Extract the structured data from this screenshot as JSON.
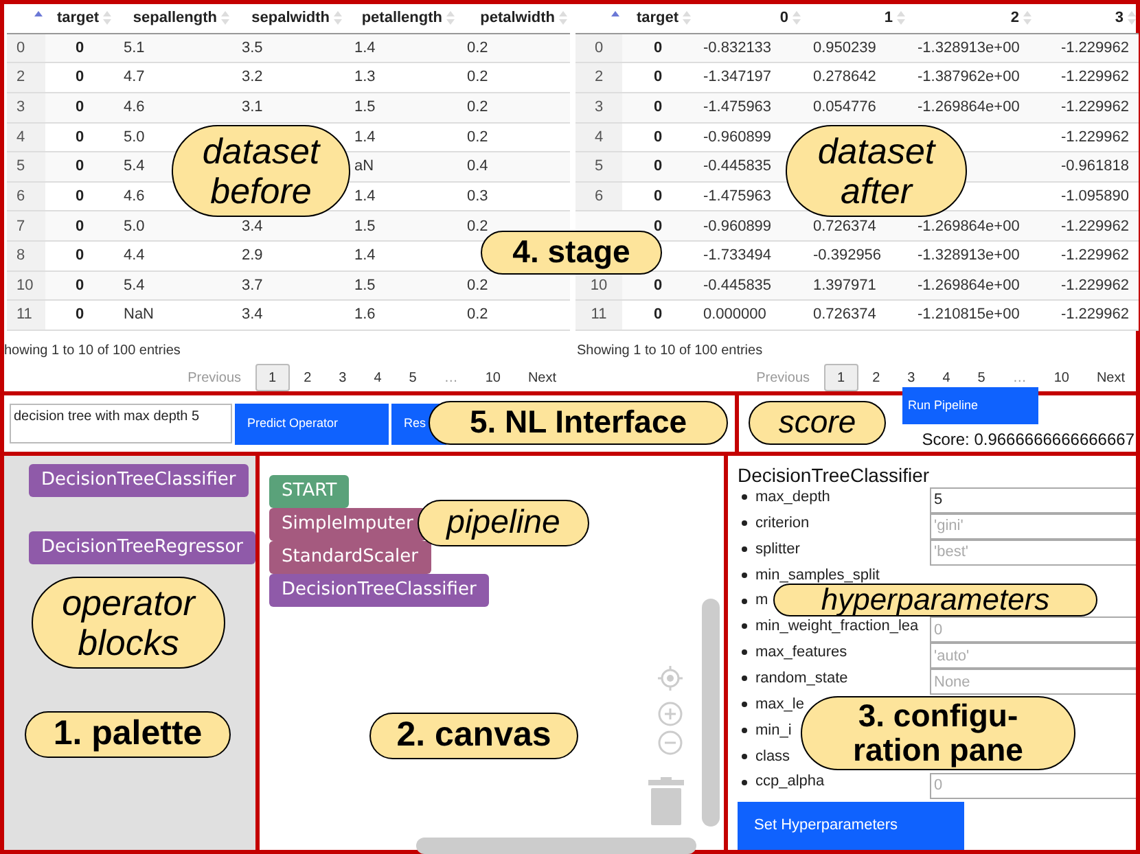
{
  "stage": {
    "tables": [
      {
        "columns": [
          {
            "sorted": true
          },
          {
            "label": "target",
            "sorted": false
          },
          {
            "label": "sepallength",
            "sorted": false
          },
          {
            "label": "sepalwidth",
            "sorted": false
          },
          {
            "label": "petallength",
            "sorted": false
          },
          {
            "label": "petalwidth",
            "sorted": false
          }
        ],
        "rows": [
          [
            "0",
            "0",
            "5.1",
            "3.5",
            "1.4",
            "0.2"
          ],
          [
            "2",
            "0",
            "4.7",
            "3.2",
            "1.3",
            "0.2"
          ],
          [
            "3",
            "0",
            "4.6",
            "3.1",
            "1.5",
            "0.2"
          ],
          [
            "4",
            "0",
            "5.0",
            null,
            "1.4",
            "0.2"
          ],
          [
            "5",
            "0",
            "5.4",
            null,
            "aN",
            "0.4"
          ],
          [
            "6",
            "0",
            "4.6",
            null,
            "1.4",
            "0.3"
          ],
          [
            "7",
            "0",
            "5.0",
            "3.4",
            "1.5",
            "0.2"
          ],
          [
            "8",
            "0",
            "4.4",
            "2.9",
            "1.4",
            null
          ],
          [
            "10",
            "0",
            "5.4",
            "3.7",
            "1.5",
            "0.2"
          ],
          [
            "11",
            "0",
            "NaN",
            "3.4",
            "1.6",
            "0.2"
          ]
        ],
        "info": "howing 1 to 10 of 100 entries",
        "pagination": [
          {
            "label": "Previous",
            "selected": false,
            "disabled": true
          },
          {
            "label": "1",
            "selected": true,
            "disabled": false
          },
          {
            "label": "2",
            "selected": false,
            "disabled": false
          },
          {
            "label": "3",
            "selected": false,
            "disabled": false
          },
          {
            "label": "4",
            "selected": false,
            "disabled": false
          },
          {
            "label": "5",
            "selected": false,
            "disabled": false
          },
          {
            "label": "…",
            "selected": false,
            "disabled": true
          },
          {
            "label": "10",
            "selected": false,
            "disabled": false
          },
          {
            "label": "Next",
            "selected": false,
            "disabled": false
          }
        ]
      },
      {
        "columns": [
          {
            "sorted": true
          },
          {
            "label": "target",
            "sorted": false
          },
          {
            "label": "0",
            "sorted": false
          },
          {
            "label": "1",
            "sorted": false
          },
          {
            "label": "2",
            "sorted": false
          },
          {
            "label": "3",
            "sorted": false
          }
        ],
        "rows": [
          [
            "0",
            "0",
            "-0.832133",
            "0.950239",
            "-1.328913e+00",
            "-1.229962"
          ],
          [
            "2",
            "0",
            "-1.347197",
            "0.278642",
            "-1.387962e+00",
            "-1.229962"
          ],
          [
            "3",
            "0",
            "-1.475963",
            "0.054776",
            "-1.269864e+00",
            "-1.229962"
          ],
          [
            "4",
            "0",
            "-0.960899",
            null,
            null,
            "-1.229962"
          ],
          [
            "5",
            "0",
            "-0.445835",
            null,
            null,
            "-0.961818"
          ],
          [
            "6",
            "0",
            "-1.475963",
            null,
            null,
            "-1.095890"
          ],
          [
            null,
            "0",
            "-0.960899",
            "0.726374",
            "-1.269864e+00",
            "-1.229962"
          ],
          [
            null,
            null,
            "-1.733494",
            "-0.392956",
            "-1.328913e+00",
            "-1.229962"
          ],
          [
            "10",
            "0",
            "-0.445835",
            "1.397971",
            "-1.269864e+00",
            "-1.229962"
          ],
          [
            "11",
            "0",
            "0.000000",
            "0.726374",
            "-1.210815e+00",
            "-1.229962"
          ]
        ],
        "info": "Showing 1 to 10 of 100 entries",
        "pagination": [
          {
            "label": "Previous",
            "selected": false,
            "disabled": true
          },
          {
            "label": "1",
            "selected": true,
            "disabled": false
          },
          {
            "label": "2",
            "selected": false,
            "disabled": false
          },
          {
            "label": "3",
            "selected": false,
            "disabled": false
          },
          {
            "label": "4",
            "selected": false,
            "disabled": false
          },
          {
            "label": "5",
            "selected": false,
            "disabled": false
          },
          {
            "label": "…",
            "selected": false,
            "disabled": true
          },
          {
            "label": "10",
            "selected": false,
            "disabled": false
          },
          {
            "label": "Next",
            "selected": false,
            "disabled": false
          }
        ]
      }
    ]
  },
  "nl_interface": {
    "query": "decision tree with max depth 5",
    "buttons": [
      "Predict Operator",
      "Res"
    ]
  },
  "score_panel": {
    "button": "Run Pipeline",
    "score": "Score: 0.9666666666666667"
  },
  "palette": {
    "blocks": [
      {
        "label": "DecisionTreeClassifier",
        "color": "#8f5aa9"
      },
      {
        "label": "DecisionTreeRegressor",
        "color": "#8f5aa9"
      }
    ]
  },
  "canvas": {
    "blocks": [
      {
        "label": "START",
        "color": "#5aa27a"
      },
      {
        "label": "SimpleImputer",
        "color": "#a55a7f"
      },
      {
        "label": "StandardScaler",
        "color": "#a55a7f"
      },
      {
        "label": "DecisionTreeClassifier",
        "color": "#8f5aa9"
      }
    ]
  },
  "config": {
    "title": "DecisionTreeClassifier",
    "params": [
      {
        "label": "max_depth",
        "value": "5"
      },
      {
        "label": "criterion",
        "placeholder": "'gini'"
      },
      {
        "label": "splitter",
        "placeholder": "'best'"
      },
      {
        "label": "min_samples_split"
      },
      {
        "label": "m"
      },
      {
        "label": "min_weight_fraction_lea",
        "placeholder": "0"
      },
      {
        "label": "max_features",
        "placeholder": "'auto'"
      },
      {
        "label": "random_state",
        "placeholder": "None"
      },
      {
        "label": "max_le"
      },
      {
        "label": "min_i"
      },
      {
        "label": "class"
      },
      {
        "label": "ccp_alpha",
        "placeholder": "0"
      }
    ],
    "button": "Set Hyperparameters"
  },
  "annotations": [
    {
      "kind": "note",
      "lines": [
        "dataset",
        "before"
      ]
    },
    {
      "kind": "section",
      "lines": [
        "4. stage"
      ]
    },
    {
      "kind": "note",
      "lines": [
        "dataset",
        "after"
      ]
    },
    {
      "kind": "section",
      "lines": [
        "5. NL Interface"
      ]
    },
    {
      "kind": "note",
      "lines": [
        "score"
      ]
    },
    {
      "kind": "note",
      "lines": [
        "operator",
        "blocks"
      ]
    },
    {
      "kind": "note",
      "lines": [
        "pipeline"
      ]
    },
    {
      "kind": "note",
      "lines": [
        "hyperparameters"
      ]
    },
    {
      "kind": "section",
      "lines": [
        "1. palette"
      ]
    },
    {
      "kind": "section",
      "lines": [
        "2. canvas"
      ]
    },
    {
      "kind": "section",
      "lines": [
        "3. configu-",
        "ration pane"
      ]
    }
  ]
}
